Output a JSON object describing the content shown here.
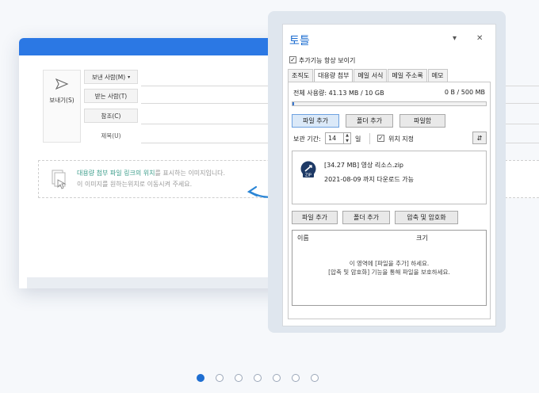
{
  "compose": {
    "send_label": "보내기(S)",
    "from_label": "보낸 사람(M)",
    "to_label": "받는 사람(T)",
    "cc_label": "참조(C)",
    "subject_label": "제목(U)",
    "drop_text1_highlight": "대용량 첨부 파일 링크의 위치",
    "drop_text1_rest": "를 표시하는 이미지입니다.",
    "drop_text2": "이 이미지를 원하는위치로 이동시켜 주세요."
  },
  "panel": {
    "title": "토틀",
    "minimize_icon": "▾",
    "close_icon": "✕",
    "show_always_label": "추가기능 항상 보이기",
    "show_always_checked": true,
    "tabs": [
      {
        "label": "조직도",
        "active": false
      },
      {
        "label": "대용량 첨부",
        "active": true
      },
      {
        "label": "메일 서식",
        "active": false
      },
      {
        "label": "메일 주소록",
        "active": false
      },
      {
        "label": "메모",
        "active": false
      }
    ],
    "usage_label": "전체 사용량: 41.13 MB / 10 GB",
    "usage_right": "0 B / 500 MB",
    "usage_fraction": 0.004,
    "buttons_top": {
      "add_file": "파일 추가",
      "add_folder": "폴더 추가",
      "file_box": "파일함"
    },
    "period_label": "보관 기간:",
    "period_value": "14",
    "period_unit": "일",
    "location_label": "위치 지정",
    "location_checked": true,
    "file": {
      "name": "[34.27 MB]  영상 리소스.zip",
      "date": "2021-08-09 까지 다운로드 가능",
      "icon": "zip-icon"
    },
    "buttons_bottom": {
      "add_file": "파일 추가",
      "add_folder": "폴더 추가",
      "compress": "압축 및 암호화"
    },
    "list_columns": {
      "name": "이름",
      "size": "크기"
    },
    "empty_line1": "이 영역에 [파일을 추가] 하세요.",
    "empty_line2": "[압축 및 암호화] 기능을 통해 파일을 보호하세요."
  },
  "colors": {
    "accent": "#1e6ed1",
    "compose_bar": "#2b78e4",
    "highlight_text": "#3a9c8a"
  },
  "pagination": {
    "count": 7,
    "active_index": 0
  }
}
